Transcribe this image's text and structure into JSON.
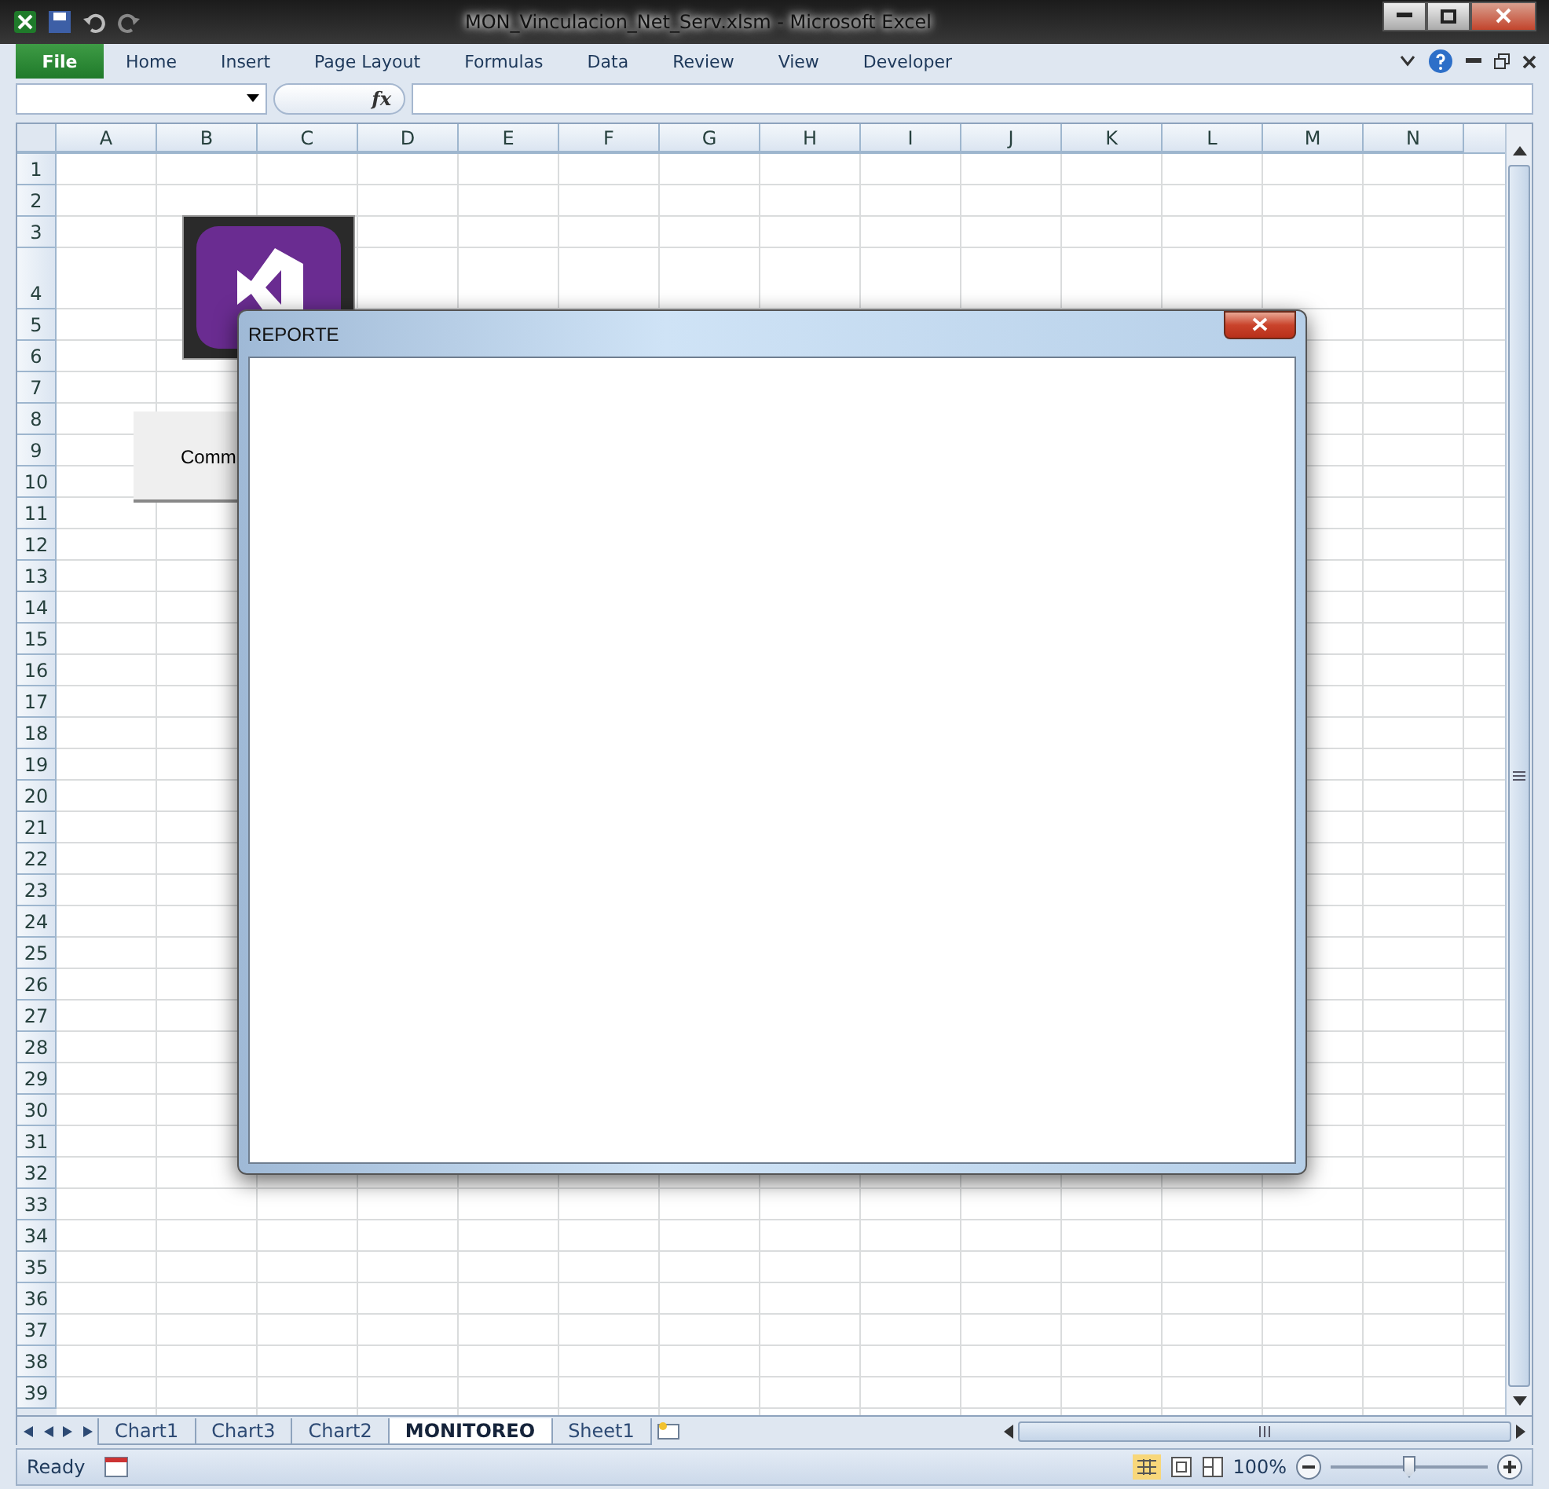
{
  "window": {
    "title": "MON_Vinculacion_Net_Serv.xlsm  -  Microsoft Excel"
  },
  "file_button": "File",
  "ribbon_tabs": [
    "Home",
    "Insert",
    "Page Layout",
    "Formulas",
    "Data",
    "Review",
    "View",
    "Developer"
  ],
  "formula_bar": {
    "fx_label": "fx"
  },
  "columns": [
    "A",
    "B",
    "C",
    "D",
    "E",
    "F",
    "G",
    "H",
    "I",
    "J",
    "K",
    "L",
    "M",
    "N"
  ],
  "rows": [
    "1",
    "2",
    "3",
    "4",
    "5",
    "6",
    "7",
    "8",
    "9",
    "10",
    "11",
    "12",
    "13",
    "14",
    "15",
    "16",
    "17",
    "18",
    "19",
    "20",
    "21",
    "22",
    "23",
    "24",
    "25",
    "26",
    "27",
    "28",
    "29",
    "30",
    "31",
    "32",
    "33",
    "34",
    "35",
    "36",
    "37",
    "38",
    "39"
  ],
  "command_button": {
    "label": "Comm"
  },
  "dialog": {
    "title": "REPORTE"
  },
  "sheet_tabs": [
    {
      "label": "Chart1",
      "selected": false
    },
    {
      "label": "Chart3",
      "selected": false
    },
    {
      "label": "Chart2",
      "selected": false
    },
    {
      "label": "MONITOREO",
      "selected": true
    },
    {
      "label": "Sheet1",
      "selected": false
    }
  ],
  "status_bar": {
    "status": "Ready",
    "zoom": "100%",
    "zoom_slider": {
      "level": 0.5
    }
  }
}
